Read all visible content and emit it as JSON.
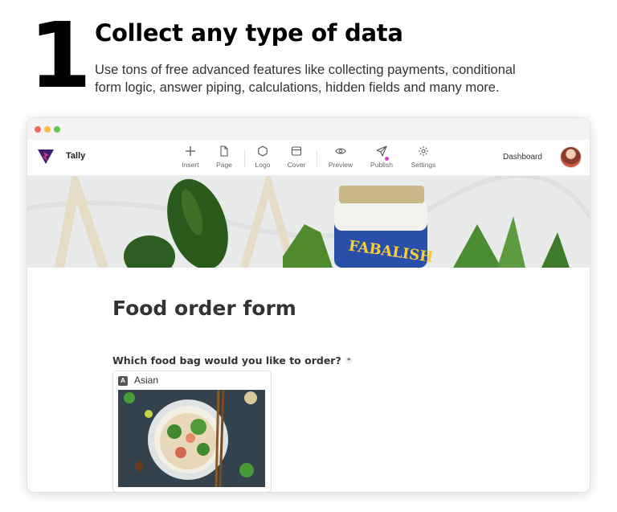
{
  "hero": {
    "step_number": "1",
    "headline": "Collect any type of data",
    "description": "Use tons of free advanced features like collecting payments, conditional form logic, answer piping, calculations, hidden fields and many more."
  },
  "app": {
    "brand": "Tally",
    "toolbar": [
      {
        "label": "Insert",
        "icon": "plus-icon"
      },
      {
        "label": "Page",
        "icon": "page-icon"
      },
      {
        "label": "Logo",
        "icon": "hexagon-icon"
      },
      {
        "label": "Cover",
        "icon": "cover-icon"
      },
      {
        "label": "Preview",
        "icon": "eye-icon"
      },
      {
        "label": "Publish",
        "icon": "send-icon"
      },
      {
        "label": "Settings",
        "icon": "gear-icon"
      }
    ],
    "dashboard_label": "Dashboard",
    "cover_jar_text": "FABALISH"
  },
  "form": {
    "title": "Food order form",
    "question": "Which food bag would you like to order?",
    "required_mark": "*",
    "options": [
      {
        "key": "A",
        "label": "Asian"
      }
    ]
  },
  "colors": {
    "accent": "#e040c8",
    "logo_purple": "#3b1e6e",
    "logo_pink": "#d0318f"
  }
}
